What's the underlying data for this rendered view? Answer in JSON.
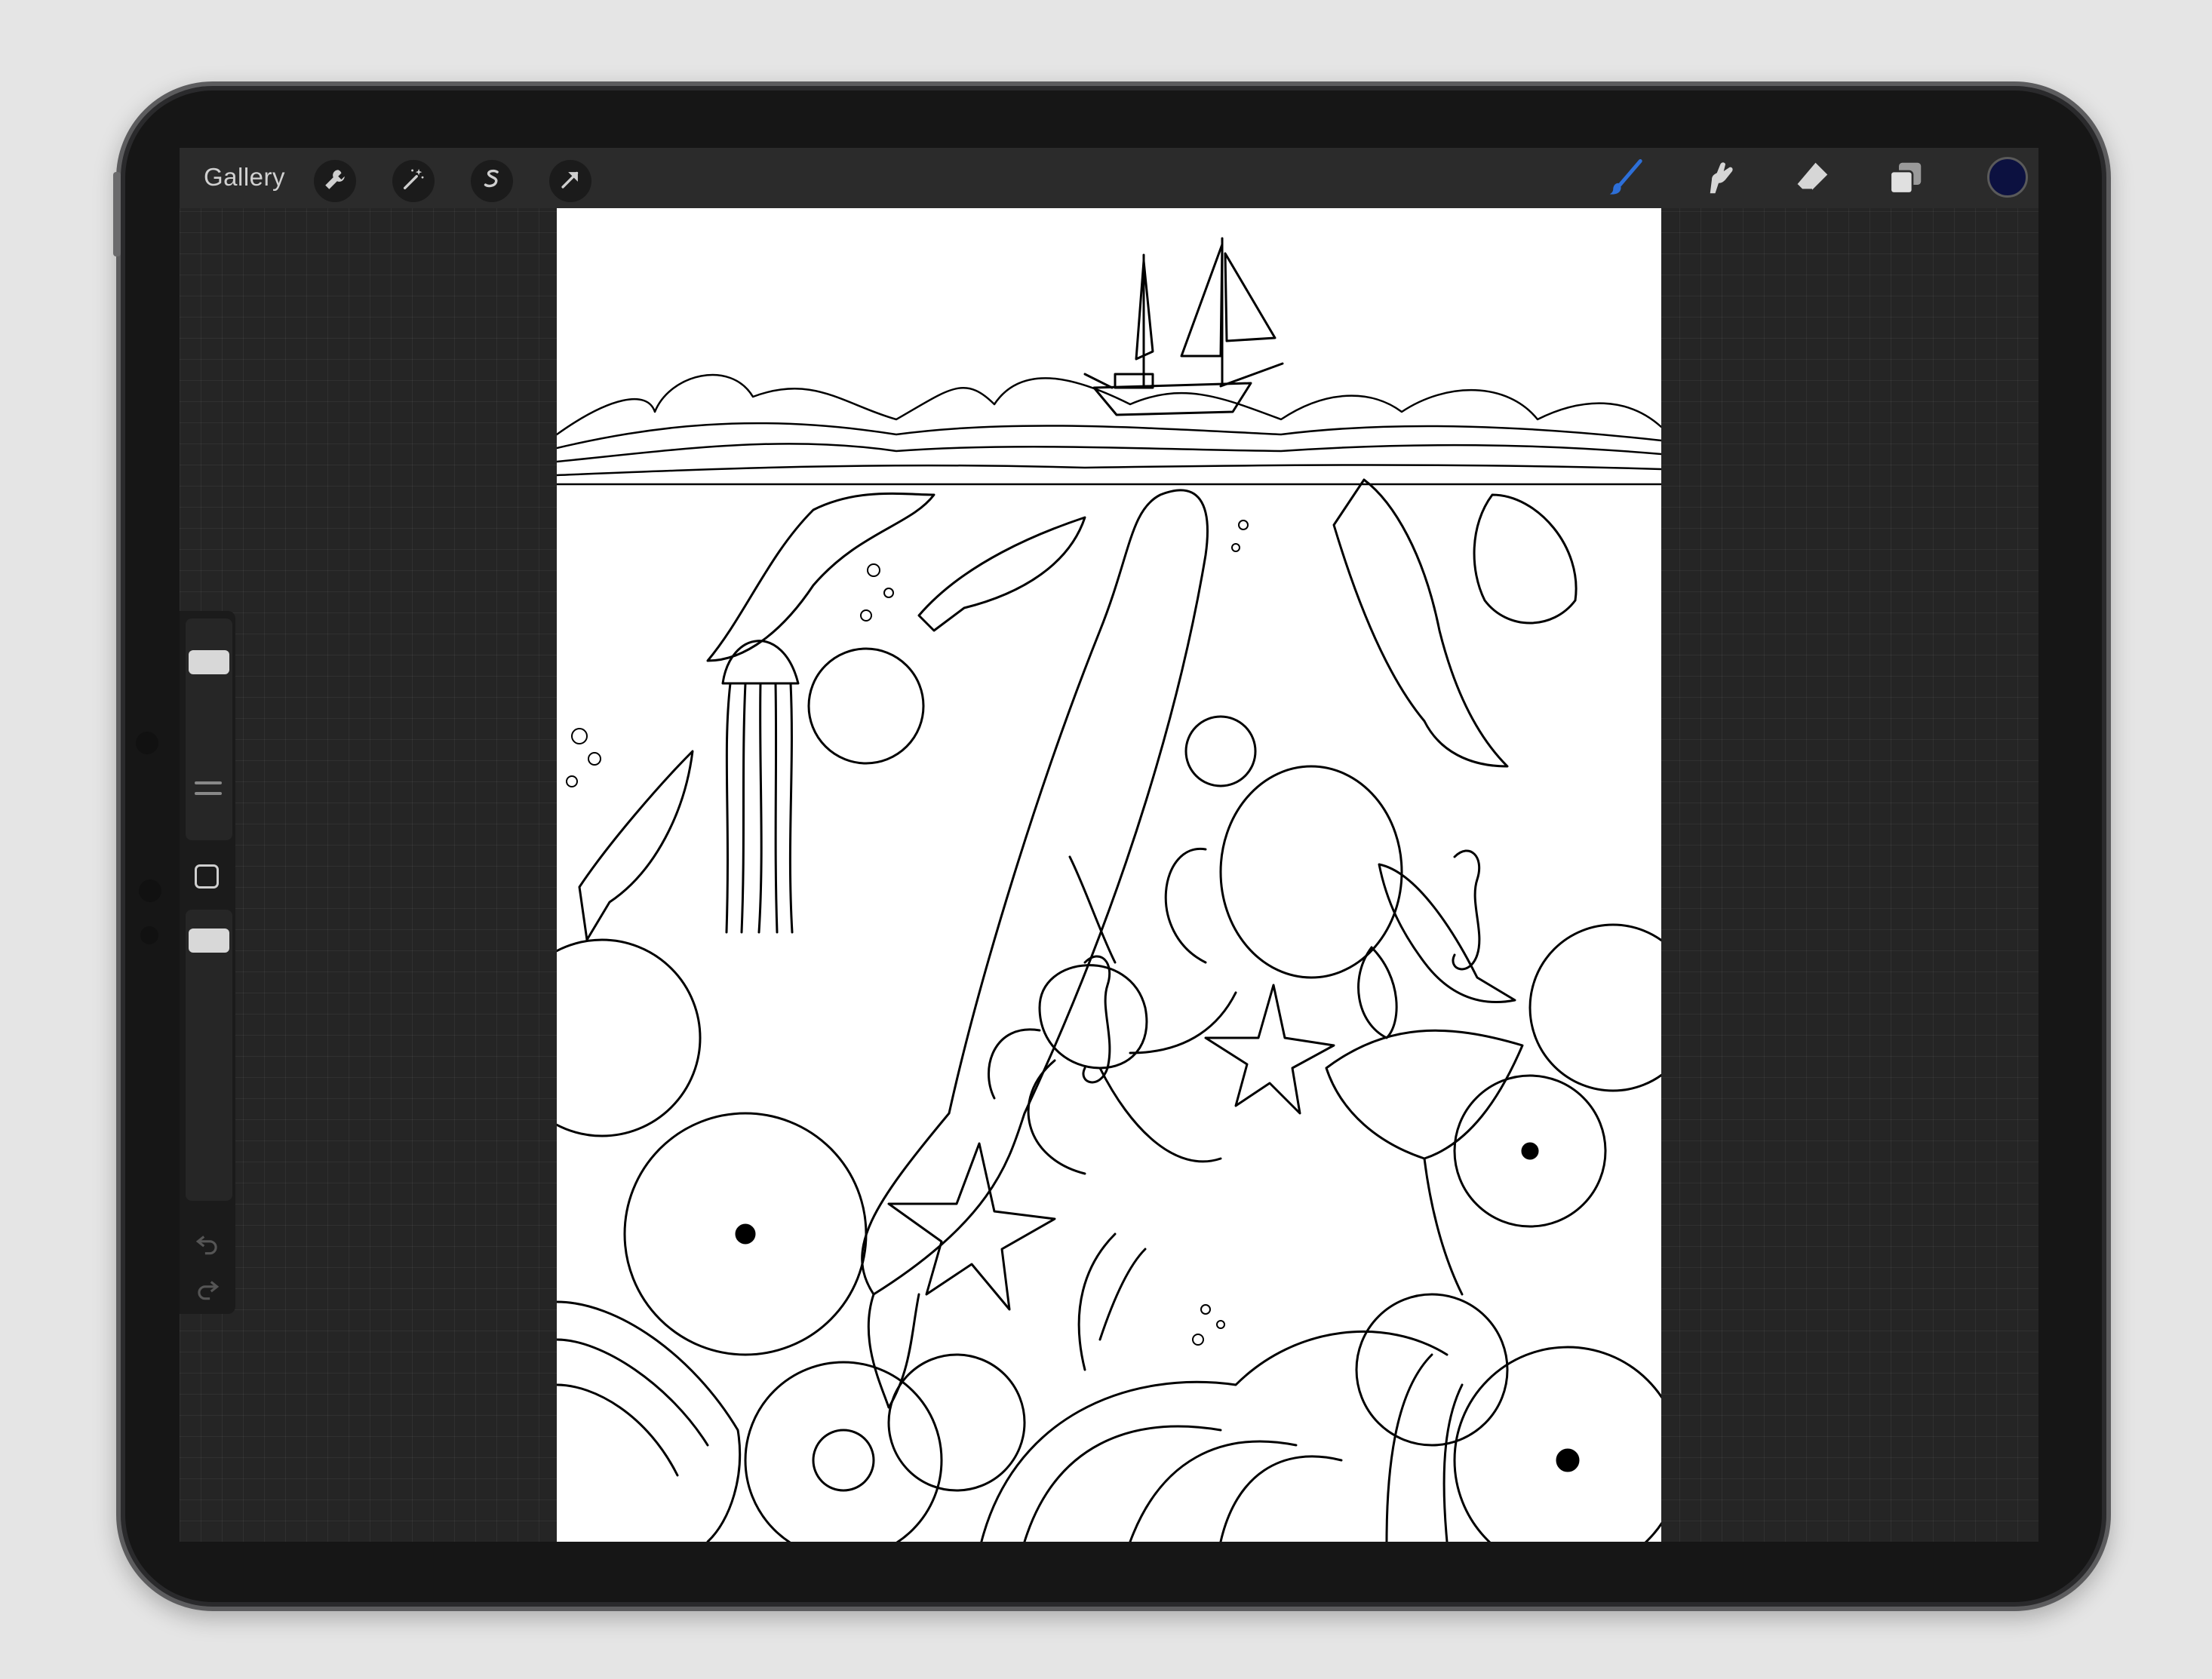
{
  "app": {
    "gallery_label": "Gallery",
    "left_tools": [
      "wrench-icon",
      "magic-wand-icon",
      "selection-icon",
      "transform-arrow-icon"
    ],
    "right_tools": [
      "brush-icon",
      "smudge-icon",
      "eraser-icon",
      "layers-icon"
    ],
    "active_tool": "brush-icon",
    "active_color": "#0c1140",
    "accent_color": "#2d6fd8"
  },
  "sidebar": {
    "brush_size_level": 0.86,
    "opacity_level": 0.95,
    "modify_button_icon": "square-icon",
    "undo_icon": "undo-arrow-icon",
    "redo_icon": "redo-arrow-icon"
  },
  "canvas": {
    "artwork": "ocean-coloring-page",
    "background_color": "#ffffff",
    "ink_color": "#000000"
  }
}
